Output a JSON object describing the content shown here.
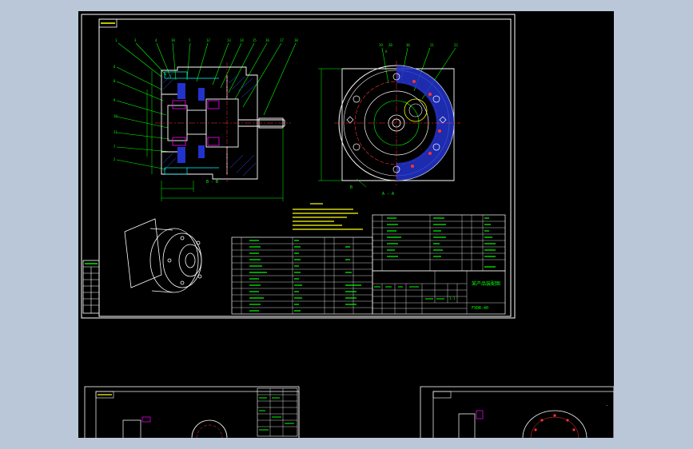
{
  "colors": {
    "background": "#b9c7d9",
    "canvas": "#000000",
    "sheet_border": "#ffffff",
    "outline": "#ffffff",
    "dimension": "#00ff00",
    "leader": "#00ff00",
    "centerline": "#ff3333",
    "hidden": "#ff00ff",
    "section": "#00ffff",
    "notes": "#ffff00",
    "table_text": "#00ff00",
    "hatch": "#3355ff",
    "fill_blue": "#2233cc"
  },
  "drawing": {
    "section_label": "B - B",
    "view_label": "A - A",
    "arrow_label_a": "A",
    "arrow_label_b": "B",
    "title_block": {
      "name": "某产品装配图",
      "code": "FXDR-40",
      "scale_cell": "1:1"
    }
  }
}
